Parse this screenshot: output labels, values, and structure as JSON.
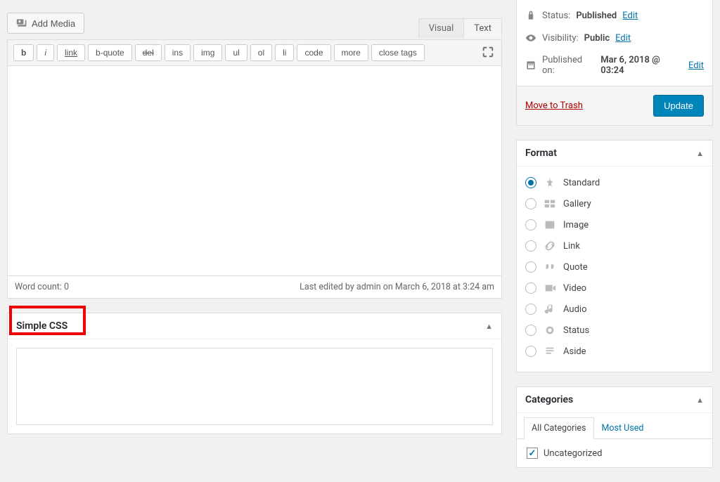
{
  "editor": {
    "add_media": "Add Media",
    "tabs": {
      "visual": "Visual",
      "text": "Text"
    },
    "toolbar": [
      "b",
      "i",
      "link",
      "b-quote",
      "del",
      "ins",
      "img",
      "ul",
      "ol",
      "li",
      "code",
      "more",
      "close tags"
    ],
    "word_count_label": "Word count: 0",
    "last_edited": "Last edited by admin on March 6, 2018 at 3:24 am"
  },
  "simple_css": {
    "title": "Simple CSS"
  },
  "publish": {
    "status_label": "Status:",
    "status_value": "Published",
    "status_edit": "Edit",
    "visibility_label": "Visibility:",
    "visibility_value": "Public",
    "visibility_edit": "Edit",
    "published_label": "Published on:",
    "published_value": "Mar 6, 2018 @ 03:24",
    "published_edit": "Edit",
    "trash": "Move to Trash",
    "update": "Update"
  },
  "format": {
    "title": "Format",
    "items": [
      {
        "label": "Standard",
        "checked": true,
        "icon": "pin"
      },
      {
        "label": "Gallery",
        "checked": false,
        "icon": "gallery"
      },
      {
        "label": "Image",
        "checked": false,
        "icon": "image"
      },
      {
        "label": "Link",
        "checked": false,
        "icon": "link"
      },
      {
        "label": "Quote",
        "checked": false,
        "icon": "quote"
      },
      {
        "label": "Video",
        "checked": false,
        "icon": "video"
      },
      {
        "label": "Audio",
        "checked": false,
        "icon": "audio"
      },
      {
        "label": "Status",
        "checked": false,
        "icon": "status"
      },
      {
        "label": "Aside",
        "checked": false,
        "icon": "aside"
      }
    ]
  },
  "categories": {
    "title": "Categories",
    "tabs": {
      "all": "All Categories",
      "most": "Most Used"
    },
    "items": [
      {
        "label": "Uncategorized",
        "checked": true
      }
    ]
  }
}
